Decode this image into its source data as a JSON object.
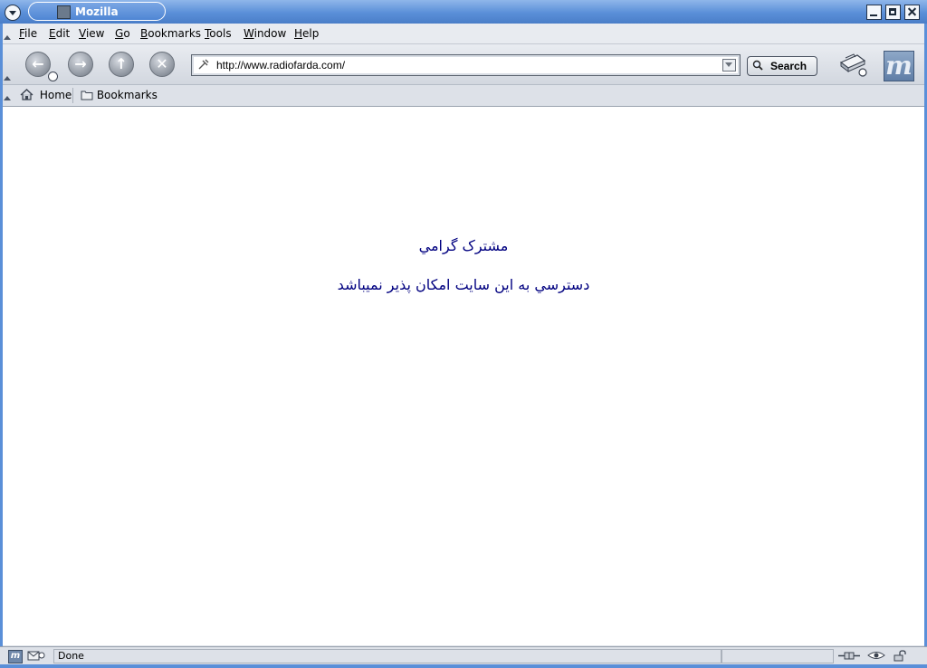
{
  "window": {
    "title": "Mozilla"
  },
  "menubar": {
    "items": [
      {
        "label": "File",
        "accel": "F",
        "rest": "ile"
      },
      {
        "label": "Edit",
        "accel": "E",
        "rest": "dit"
      },
      {
        "label": "View",
        "accel": "V",
        "rest": "iew"
      },
      {
        "label": "Go",
        "accel": "G",
        "rest": "o"
      },
      {
        "label": "Bookmarks",
        "accel": "B",
        "rest": "ookmarks"
      },
      {
        "label": "Tools",
        "accel": "T",
        "rest": "ools"
      },
      {
        "label": "Window",
        "accel": "W",
        "rest": "indow"
      },
      {
        "label": "Help",
        "accel": "H",
        "rest": "elp"
      }
    ]
  },
  "navigation": {
    "url": "http://www.radiofarda.com/",
    "search_label": "Search"
  },
  "personal_toolbar": {
    "home_label": "Home",
    "bookmarks_label": "Bookmarks"
  },
  "page": {
    "line1": "مشترک گرامي",
    "line2": "دسترسي به اين سايت امکان پذير نميباشد"
  },
  "status": {
    "text": "Done"
  },
  "colors": {
    "title_bar": "#5a8fd8",
    "page_text": "#000080"
  }
}
